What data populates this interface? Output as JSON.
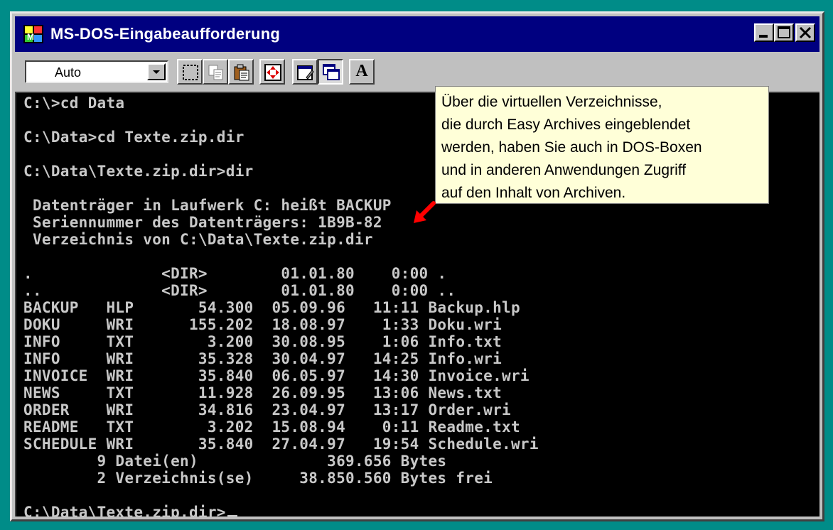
{
  "window": {
    "title": "MS-DOS-Eingabeaufforderung",
    "controls": [
      "minimize-icon",
      "maximize-icon",
      "close-icon"
    ]
  },
  "toolbar": {
    "font_size_value": "Auto",
    "font_button_label": "A",
    "tools": [
      "mark-icon",
      "copy-icon",
      "paste-icon",
      "fullscreen-icon",
      "properties-icon",
      "background-icon",
      "font-icon"
    ]
  },
  "terminal": {
    "lines": [
      "C:\\>cd Data",
      "",
      "C:\\Data>cd Texte.zip.dir",
      "",
      "C:\\Data\\Texte.zip.dir>dir",
      "",
      " Datenträger in Laufwerk C: heißt BACKUP",
      " Seriennummer des Datenträgers: 1B9B-82",
      " Verzeichnis von C:\\Data\\Texte.zip.dir",
      "",
      ".              <DIR>        01.01.80    0:00 .",
      "..             <DIR>        01.01.80    0:00 ..",
      "BACKUP   HLP       54.300  05.09.96   11:11 Backup.hlp",
      "DOKU     WRI      155.202  18.08.97    1:33 Doku.wri",
      "INFO     TXT        3.200  30.08.95    1:06 Info.txt",
      "INFO     WRI       35.328  30.04.97   14:25 Info.wri",
      "INVOICE  WRI       35.840  06.05.97   14:30 Invoice.wri",
      "NEWS     TXT       11.928  26.09.95   13:06 News.txt",
      "ORDER    WRI       34.816  23.04.97   13:17 Order.wri",
      "README   TXT        3.202  15.08.94    0:11 Readme.txt",
      "SCHEDULE WRI       35.840  27.04.97   19:54 Schedule.wri",
      "        9 Datei(en)              369.656 Bytes",
      "        2 Verzeichnis(se)     38.850.560 Bytes frei",
      "",
      "C:\\Data\\Texte.zip.dir>"
    ]
  },
  "tooltip": {
    "lines": [
      "Über die virtuellen Verzeichnisse,",
      "die durch Easy Archives eingeblendet",
      "werden, haben Sie auch in DOS-Boxen",
      "und in anderen Anwendungen Zugriff",
      "auf den Inhalt von Archiven."
    ]
  },
  "colors": {
    "desktop": "#008c88",
    "titlebar": "#000080",
    "tooltip_bg": "#ffffd8",
    "arrow": "#ff0000"
  }
}
